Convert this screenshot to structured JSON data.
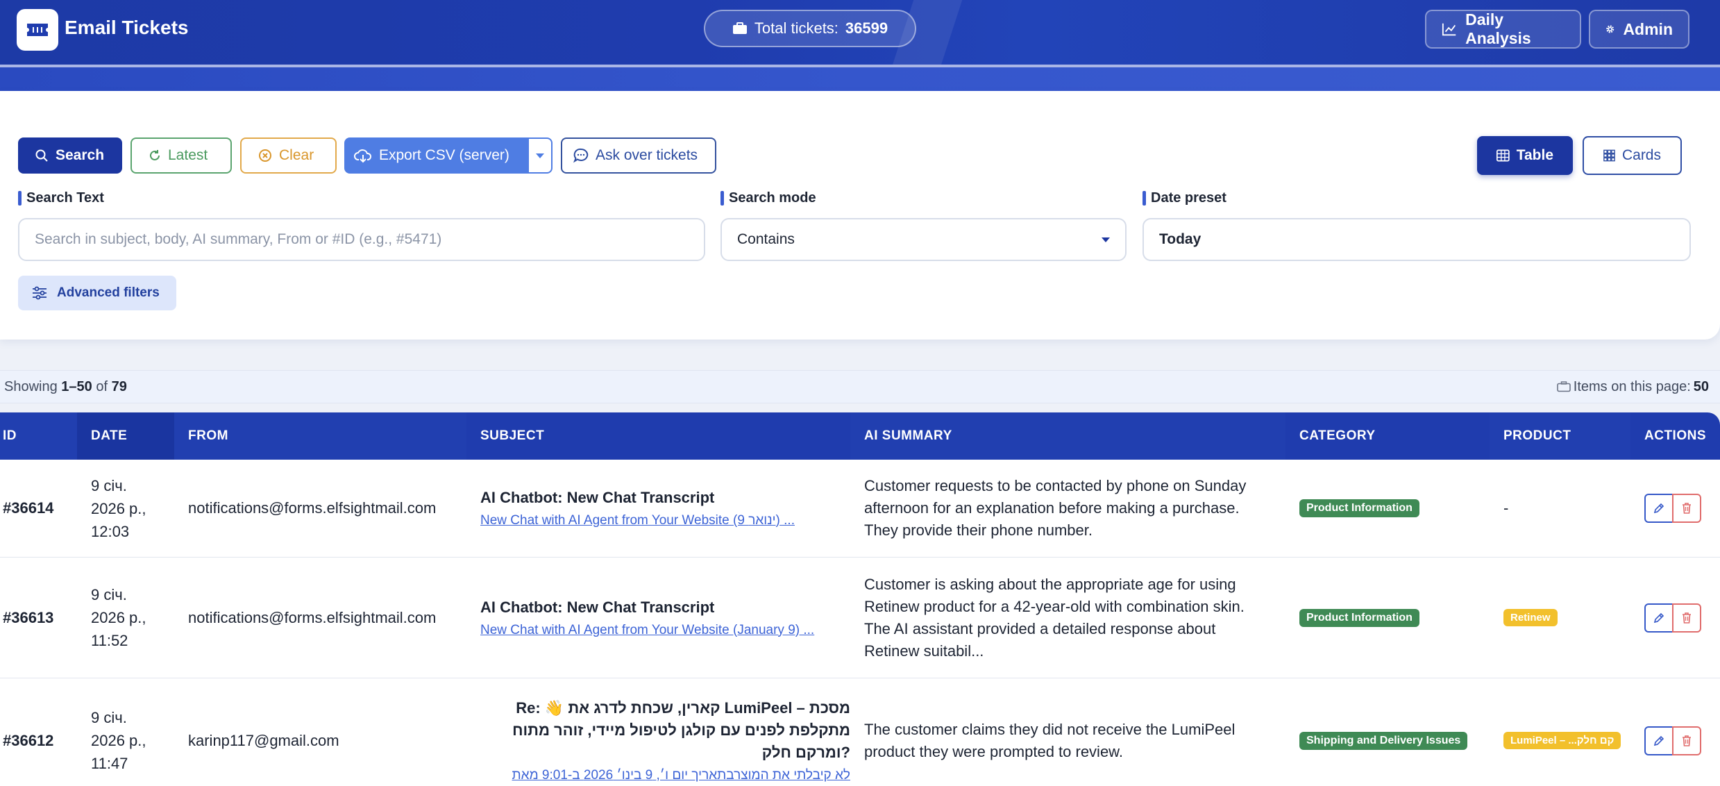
{
  "header": {
    "title": "Email Tickets",
    "total_label": "Total tickets:",
    "total_value": "36599",
    "daily_analysis": "Daily Analysis",
    "admin": "Admin"
  },
  "toolbar": {
    "search": "Search",
    "latest": "Latest",
    "clear": "Clear",
    "export": "Export CSV (server)",
    "ask": "Ask over tickets",
    "view_table": "Table",
    "view_cards": "Cards"
  },
  "filters": {
    "search_label": "Search Text",
    "search_placeholder": "Search in subject, body, AI summary, From or #ID (e.g., #5471)",
    "mode_label": "Search mode",
    "mode_value": "Contains",
    "preset_label": "Date preset",
    "preset_value": "Today",
    "advanced": "Advanced filters"
  },
  "results": {
    "showing_prefix": "Showing ",
    "range": "1–50",
    "of": " of ",
    "total": "79",
    "items_label": "Items on this page: ",
    "items_value": "50"
  },
  "table": {
    "headers": [
      "ID",
      "DATE",
      "FROM",
      "SUBJECT",
      "AI SUMMARY",
      "CATEGORY",
      "PRODUCT",
      "ACTIONS"
    ],
    "rows": [
      {
        "id": "#36614",
        "date": [
          "9 січ.",
          "2026 р.,",
          "12:03"
        ],
        "from": "notifications@forms.elfsightmail.com",
        "subject": "AI Chatbot: New Chat Transcript",
        "subject_link": "New Chat with AI Agent from Your Website (9 ינואר) ...",
        "summary": "Customer requests to be contacted by phone on Sunday afternoon for an explanation before making a purchase. They provide their phone number.",
        "category": "Product Information",
        "product": "-"
      },
      {
        "id": "#36613",
        "date": [
          "9 січ.",
          "2026 р.,",
          "11:52"
        ],
        "from": "notifications@forms.elfsightmail.com",
        "subject": "AI Chatbot: New Chat Transcript",
        "subject_link": "New Chat with AI Agent from Your Website (January 9) ...",
        "summary": "Customer is asking about the appropriate age for using Retinew product for a 42-year-old with combination skin. The AI assistant provided a detailed response about Retinew suitabil...",
        "category": "Product Information",
        "product": "Retinew"
      },
      {
        "id": "#36612",
        "date": [
          "9 січ.",
          "2026 р.,",
          "11:47"
        ],
        "from": "karinp117@gmail.com",
        "subject": "Re: 👋 קארין, שכחת לדרג את LumiPeel – מסכת מתקלפת לפנים עם קולגן לטיפול מיידי, זוהר מתוח ומרקם חלק?",
        "subject_link": "לא קיבלתי את המוצר‏בתאריך יום ו׳, 9 בינו׳ 2026 ב-9:01 מאת",
        "summary": "The customer claims they did not receive the LumiPeel product they were prompted to review.",
        "category": "Shipping and Delivery Issues",
        "product": "LumiPeel – ...קם חלק"
      }
    ]
  },
  "colors": {
    "header_bg": "#1f3cae",
    "primary": "#1c36a0",
    "export": "#4f7de3",
    "category_badge": "#3f8a55",
    "product_badge": "#f2c02c",
    "delete": "#e06c6c"
  },
  "icons": {
    "logo": "ticket-icon",
    "total": "briefcase-icon",
    "daily": "chart-line-icon",
    "admin": "gear-icon",
    "search": "search-icon",
    "latest": "refresh-icon",
    "clear": "close-circle-icon",
    "export": "cloud-download-icon",
    "ask": "chat-bubble-icon",
    "table": "table-icon",
    "cards": "grid-icon",
    "advanced": "sliders-icon",
    "edit": "pencil-icon",
    "delete": "trash-icon"
  }
}
